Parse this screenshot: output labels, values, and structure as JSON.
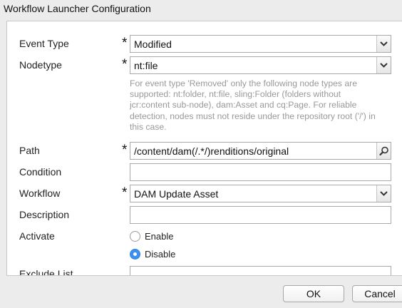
{
  "dialog": {
    "title": "Workflow Launcher Configuration"
  },
  "form": {
    "required_mark": "*",
    "event_type": {
      "label": "Event Type",
      "value": "Modified"
    },
    "nodetype": {
      "label": "Nodetype",
      "value": "nt:file",
      "help_lines": [
        "For event type 'Removed' only the following node types are",
        "supported: nt:folder, nt:file, sling:Folder (folders without",
        "jcr:content sub-node), dam:Asset and cq:Page. For reliable",
        "detection, nodes must not reside under the repository root ('/') in",
        "this case."
      ]
    },
    "path": {
      "label": "Path",
      "value": "/content/dam(/.*/)renditions/original",
      "button_icon": "search-icon"
    },
    "condition": {
      "label": "Condition",
      "value": ""
    },
    "workflow": {
      "label": "Workflow",
      "value": "DAM Update Asset"
    },
    "description": {
      "label": "Description",
      "value": ""
    },
    "activate": {
      "label": "Activate",
      "options": [
        {
          "label": "Enable",
          "selected": false
        },
        {
          "label": "Disable",
          "selected": true
        }
      ]
    },
    "exclude_list": {
      "label": "Exclude List"
    }
  },
  "buttons": {
    "ok": "OK",
    "cancel": "Cancel"
  },
  "colors": {
    "accent": "#3d8ff2"
  }
}
